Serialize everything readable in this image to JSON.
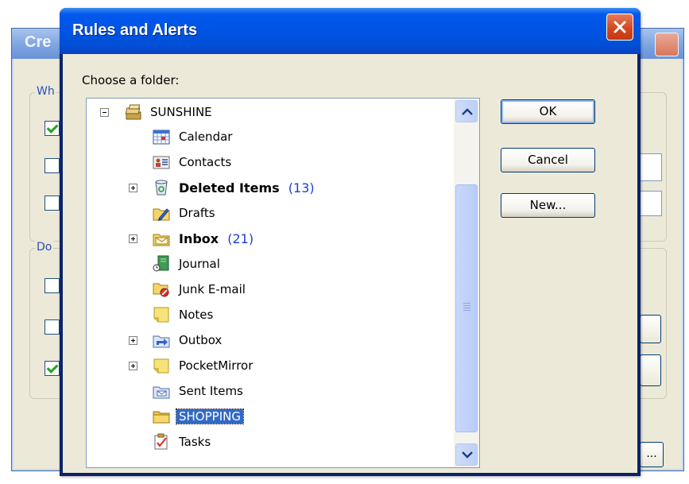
{
  "background_dialog": {
    "title": "Cre",
    "group1_label": "Wh",
    "group2_label": "Do",
    "dots_label": "..."
  },
  "dialog": {
    "title": "Rules and Alerts",
    "prompt": "Choose a folder:"
  },
  "tree": {
    "items": [
      {
        "label": "SUNSHINE",
        "icon": "mailbox-icon",
        "expander": "minus"
      },
      {
        "label": "Calendar",
        "icon": "calendar-icon"
      },
      {
        "label": "Contacts",
        "icon": "contacts-icon"
      },
      {
        "label": "Deleted Items",
        "count": "(13)",
        "bold": true,
        "icon": "trash-icon",
        "expander": "plus"
      },
      {
        "label": "Drafts",
        "icon": "drafts-icon"
      },
      {
        "label": "Inbox",
        "count": "(21)",
        "bold": true,
        "icon": "inbox-icon",
        "expander": "plus"
      },
      {
        "label": "Journal",
        "icon": "journal-icon"
      },
      {
        "label": "Junk E-mail",
        "icon": "junk-icon"
      },
      {
        "label": "Notes",
        "icon": "notes-icon"
      },
      {
        "label": "Outbox",
        "icon": "outbox-icon",
        "expander": "plus"
      },
      {
        "label": "PocketMirror",
        "icon": "folder-icon",
        "expander": "plus"
      },
      {
        "label": "Sent Items",
        "icon": "sent-icon"
      },
      {
        "label": "SHOPPING",
        "icon": "folder-icon",
        "selected": true
      },
      {
        "label": "Tasks",
        "icon": "tasks-icon"
      }
    ]
  },
  "buttons": {
    "ok": "OK",
    "cancel": "Cancel",
    "new": "New..."
  },
  "colors": {
    "selection": "#316ac5",
    "count": "#1a3fd8",
    "titlebar": "#0054e3"
  }
}
